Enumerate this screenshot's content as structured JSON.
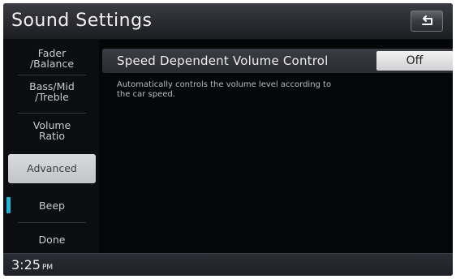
{
  "header": {
    "title": "Sound Settings",
    "back_icon": "back-arrow-icon"
  },
  "sidebar": {
    "items": [
      {
        "label_line1": "Fader",
        "label_line2": "/Balance",
        "selected": false
      },
      {
        "label_line1": "Bass/Mid",
        "label_line2": "/Treble",
        "selected": false
      },
      {
        "label_line1": "Volume",
        "label_line2": "Ratio",
        "selected": false
      },
      {
        "label": "Advanced",
        "selected": true
      },
      {
        "label": "Beep",
        "indicator_color": "#1fb6d8",
        "indicator_on": true
      },
      {
        "label": "Done"
      }
    ]
  },
  "main": {
    "setting": {
      "label": "Speed Dependent Volume Control",
      "value": "Off"
    },
    "description_line1": "Automatically controls the volume level according to",
    "description_line2": "the car speed."
  },
  "footer": {
    "time": "3:25",
    "ampm": "PM"
  },
  "colors": {
    "accent": "#1fb6d8",
    "selected_bg": "#cfd0d3",
    "background": "#050608"
  }
}
